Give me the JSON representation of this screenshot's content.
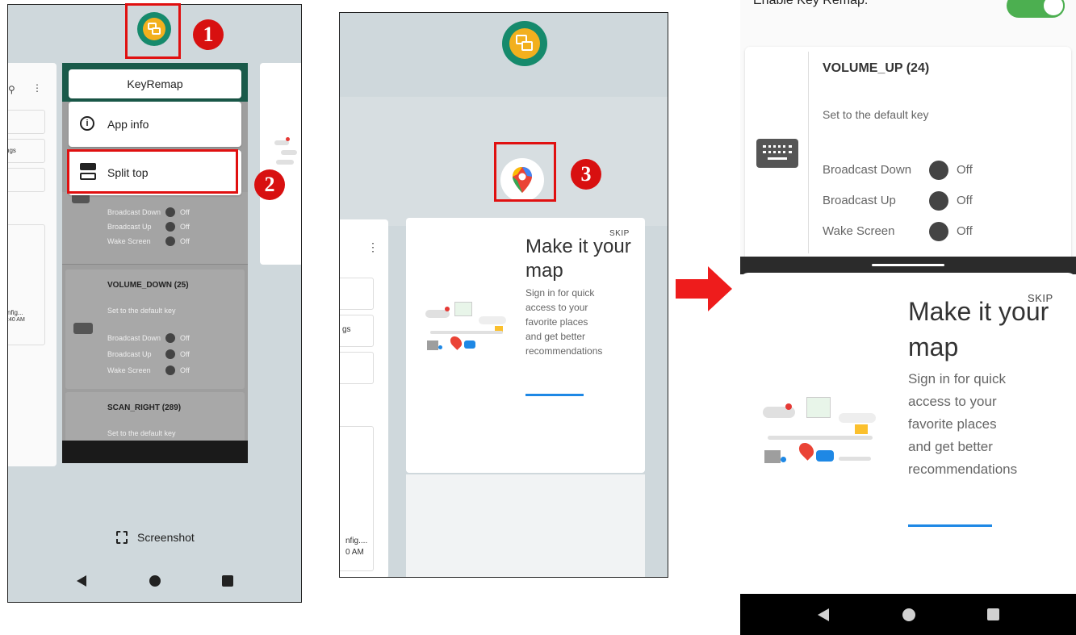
{
  "annotations": {
    "badge1": "1",
    "badge2": "2",
    "badge3": "3",
    "accent_red": "#e01010"
  },
  "panel1": {
    "app_title": "KeyRemap",
    "menu": {
      "app_info": "App info",
      "split_top": "Split top"
    },
    "bg_card_rows": [
      {
        "label": "Broadcast Down",
        "state": "Off"
      },
      {
        "label": "Broadcast Up",
        "state": "Off"
      },
      {
        "label": "Wake Screen",
        "state": "Off"
      }
    ],
    "volume_down": {
      "title": "VOLUME_DOWN (25)",
      "subtitle": "Set to the default key",
      "rows": [
        {
          "label": "Broadcast Down",
          "state": "Off"
        },
        {
          "label": "Broadcast Up",
          "state": "Off"
        },
        {
          "label": "Wake Screen",
          "state": "Off"
        }
      ]
    },
    "scan_right": {
      "title": "SCAN_RIGHT (289)",
      "subtitle": "Set to the default key"
    },
    "left_fragments": {
      "ngs": "ngs",
      "config": "nfig...",
      "time": ":40 AM"
    },
    "screenshot_label": "Screenshot",
    "nav": [
      "back-icon",
      "home-icon",
      "recents-icon"
    ]
  },
  "panel2": {
    "skip": "SKIP",
    "title_line1": "Make it your",
    "title_line2": "map",
    "body": [
      "Sign in for quick",
      "access to your",
      "favorite places",
      "and get better",
      "recommendations"
    ],
    "left_fragments": {
      "gs": "gs",
      "config": "nfig....",
      "time": "0 AM"
    }
  },
  "panel3": {
    "enable_label": "Enable Key Remap:",
    "toggle_color": "#4caf50",
    "key_title": "VOLUME_UP (24)",
    "key_subtitle": "Set to the default key",
    "rows": [
      {
        "label": "Broadcast Down",
        "state": "Off"
      },
      {
        "label": "Broadcast Up",
        "state": "Off"
      },
      {
        "label": "Wake Screen",
        "state": "Off"
      }
    ],
    "skip": "SKIP",
    "title_line1": "Make it your",
    "title_line2": "map",
    "body": [
      "Sign in for quick",
      "access to your",
      "favorite places",
      "and get better",
      "recommendations"
    ],
    "nav": [
      "back-icon",
      "home-icon",
      "recents-icon"
    ]
  }
}
